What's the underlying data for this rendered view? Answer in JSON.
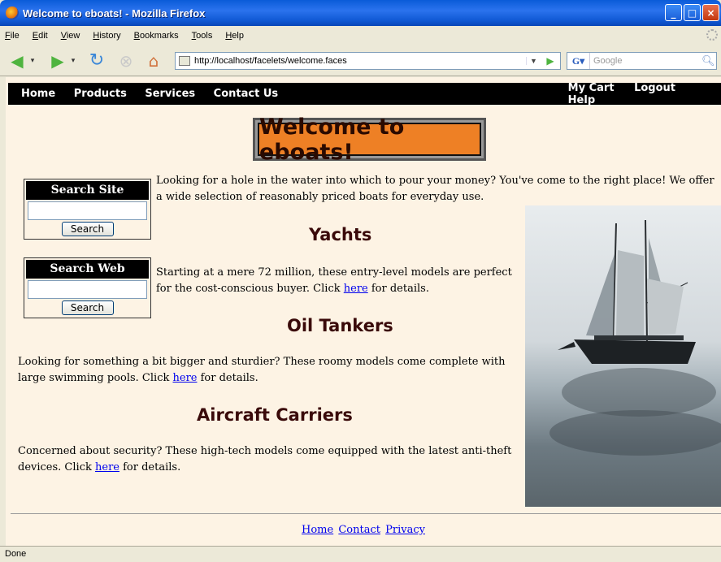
{
  "window": {
    "title": "Welcome to eboats! - Mozilla Firefox",
    "buttons": [
      "_",
      "□",
      "×"
    ]
  },
  "menu": [
    "File",
    "Edit",
    "View",
    "History",
    "Bookmarks",
    "Tools",
    "Help"
  ],
  "toolbar": {
    "url": "http://localhost/facelets/welcome.faces",
    "search_placeholder": "Google",
    "search_engine": "G"
  },
  "status": "Done",
  "site_nav": {
    "left": [
      "Home",
      "Products",
      "Services",
      "Contact Us"
    ],
    "right": [
      "My Cart",
      "Logout",
      "Help"
    ]
  },
  "banner": "Welcome to eboats!",
  "search_site": {
    "title": "Search Site",
    "button": "Search"
  },
  "search_web": {
    "title": "Search Web",
    "button": "Search"
  },
  "intro": "Looking for a hole in the water into which to pour your money? You've come to the right place! We offer a wide selection of reasonably priced boats for everyday use.",
  "sections": [
    {
      "heading": "Yachts",
      "text": "Starting at a mere 72 million, these entry-level models are perfect for the cost-conscious buyer. Click",
      "link": "here",
      "tail": "for details."
    },
    {
      "heading": "Oil Tankers",
      "text": "Looking for something a bit bigger and sturdier? These roomy models come complete with large swimming pools. Click",
      "link": "here",
      "tail": "for details."
    },
    {
      "heading": "Aircraft Carriers",
      "text": "Concerned about security? These high-tech models come equipped with the latest anti-theft devices. Click",
      "link": "here",
      "tail": "for details."
    }
  ],
  "footer_links": [
    "Home",
    "Contact",
    "Privacy"
  ],
  "colors": {
    "nav_bg": "#000000",
    "banner_bg": "#ee8025",
    "page_bg": "#fdf3e4",
    "link": "#0000ee",
    "heading": "#3a0a0a"
  }
}
